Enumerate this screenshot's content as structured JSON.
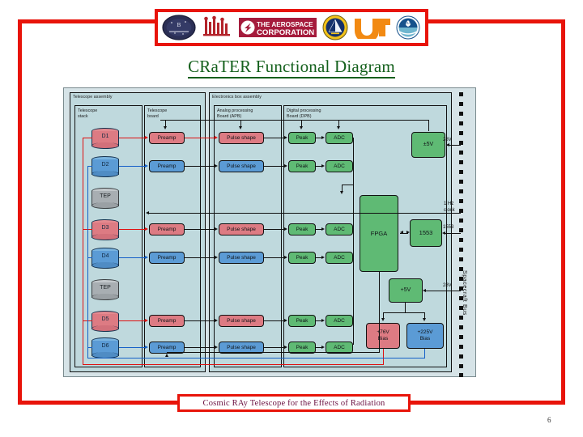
{
  "slide": {
    "title": "CRaTER Functional Diagram",
    "page_number": "6",
    "footer_text": "Cosmic RAy Telescope for the Effects of Radiation",
    "accent_red": "#e8140a",
    "title_green": "#14601c",
    "footer_purple": "#6a1040"
  },
  "logos": [
    {
      "name": "boston-university-seal",
      "alt": "Boston University seal"
    },
    {
      "name": "mit-seal",
      "alt": "MIT seal"
    },
    {
      "name": "aerospace-corporation-logo",
      "text": "THE AEROSPACE CORPORATION"
    },
    {
      "name": "air-force-research-lab-logo",
      "alt": "Air Force emblem"
    },
    {
      "name": "university-of-tennessee-logo",
      "text": "UT"
    },
    {
      "name": "noaa-logo",
      "alt": "NOAA seal"
    }
  ],
  "diagram": {
    "assemblies": [
      {
        "id": "telescope-assembly",
        "label": "Telescope assembly"
      },
      {
        "id": "electronics-box-assembly",
        "label": "Electronics box assembly"
      }
    ],
    "boards": [
      {
        "id": "telescope-stack",
        "label": "Telescope\nstack"
      },
      {
        "id": "telescope-board",
        "label": "Telescope\nboard"
      },
      {
        "id": "analog-processing-board",
        "label": "Analog processing\nBoard (APB)"
      },
      {
        "id": "digital-processing-board",
        "label": "Digital processing\nBoard (DPB)"
      }
    ],
    "detectors": [
      {
        "id": "d1",
        "label": "D1",
        "color": "red"
      },
      {
        "id": "d2",
        "label": "D2",
        "color": "blue"
      },
      {
        "id": "tep1",
        "label": "TEP",
        "color": "gray"
      },
      {
        "id": "d3",
        "label": "D3",
        "color": "red"
      },
      {
        "id": "d4",
        "label": "D4",
        "color": "blue"
      },
      {
        "id": "tep2",
        "label": "TEP",
        "color": "gray"
      },
      {
        "id": "d5",
        "label": "D5",
        "color": "red"
      },
      {
        "id": "d6",
        "label": "D6",
        "color": "blue"
      }
    ],
    "chain_labels": {
      "preamp": "Preamp",
      "pulse_shape": "Pulse shape",
      "peak": "Peak",
      "adc": "ADC"
    },
    "chains": [
      {
        "detector": "D1",
        "color": "red"
      },
      {
        "detector": "D2",
        "color": "blue"
      },
      {
        "detector": "D3",
        "color": "red"
      },
      {
        "detector": "D4",
        "color": "blue"
      },
      {
        "detector": "D5",
        "color": "red"
      },
      {
        "detector": "D6",
        "color": "blue"
      }
    ],
    "digital_blocks": [
      {
        "id": "fpga",
        "label": "FPGA",
        "color": "green"
      },
      {
        "id": "mil-std-1553",
        "label": "1553",
        "color": "green"
      }
    ],
    "power_blocks": [
      {
        "id": "minus-5v-supply",
        "label": "±5V",
        "color": "green"
      },
      {
        "id": "plus-5v-supply",
        "label": "+5V",
        "color": "green"
      },
      {
        "id": "plus-76v-bias",
        "label": "+76V\nBias",
        "color": "red"
      },
      {
        "id": "plus-225v-bias",
        "label": "+225V\nBias",
        "color": "blue"
      }
    ],
    "bus_signals": [
      {
        "id": "bus-28v-top",
        "label": "28V"
      },
      {
        "id": "bus-1hz-clock",
        "label": "1 Hz\nclock"
      },
      {
        "id": "bus-1553",
        "label": "1553"
      },
      {
        "id": "bus-28v-bottom",
        "label": "28V"
      }
    ],
    "bus_name": "Spacecraft Bus"
  }
}
